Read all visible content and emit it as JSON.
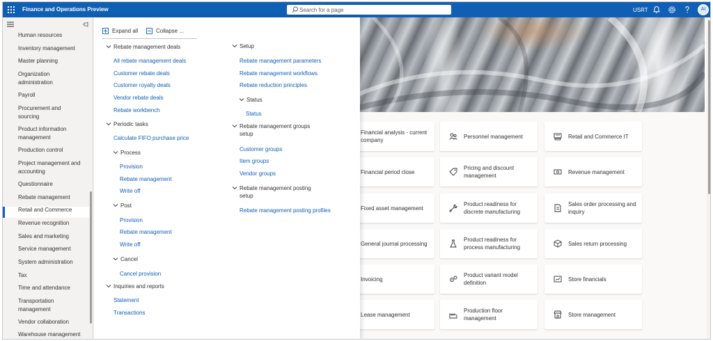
{
  "app": {
    "title": "Finance and Operations Preview",
    "company": "USRT",
    "avatar_initials": "AI",
    "accent_color": "#0f5fb4"
  },
  "search": {
    "placeholder": "Search for a page"
  },
  "topbar_icons": [
    "waffle-icon",
    "search-icon",
    "bell-icon",
    "gear-icon",
    "help-icon"
  ],
  "nav": {
    "items": [
      "Human resources",
      "Inventory management",
      "Master planning",
      "Organization administration",
      "Payroll",
      "Procurement and sourcing",
      "Product information management",
      "Production control",
      "Project management and accounting",
      "Questionnaire",
      "Rebate management",
      "Retail and Commerce",
      "Revenue recognition",
      "Sales and marketing",
      "Service management",
      "System administration",
      "Tax",
      "Time and attendance",
      "Transportation management",
      "Vendor collaboration",
      "Warehouse management"
    ],
    "selected": "Rebate management"
  },
  "flyout": {
    "expand_all": "Expand all",
    "collapse_all": "Collapse ...",
    "left": {
      "deals_header": "Rebate management deals",
      "deals_links": [
        "All rebate management deals",
        "Customer rebate deals",
        "Customer royalty deals",
        "Vendor rebate deals",
        "Rebate workbench"
      ],
      "periodic_header": "Periodic tasks",
      "fifo_link": "Calculate FIFO purchase price",
      "process_header": "Process",
      "process_links": [
        "Provision",
        "Rebate management",
        "Write off"
      ],
      "post_header": "Post",
      "post_links": [
        "Provision",
        "Rebate management",
        "Write off"
      ],
      "cancel_header": "Cancel",
      "cancel_links": [
        "Cancel provision"
      ],
      "inquiries_header": "Inquiries and reports",
      "inquiries_links": [
        "Statement",
        "Transactions"
      ]
    },
    "right": {
      "setup_header": "Setup",
      "setup_links": [
        "Rebate management parameters",
        "Rebate management workflows",
        "Rebate reduction principles"
      ],
      "status_header": "Status",
      "status_links": [
        "Status"
      ],
      "groups_header": "Rebate management groups setup",
      "groups_links": [
        "Customer groups",
        "Item groups",
        "Vendor groups"
      ],
      "posting_header": "Rebate management posting setup",
      "posting_links": [
        "Rebate management posting profiles"
      ]
    }
  },
  "tiles": {
    "col1": [
      "Financial analysis - current company",
      "Financial period close",
      "Fixed asset management",
      "General journal processing",
      "Invoicing",
      "Lease management"
    ],
    "col2": [
      "Personnel management",
      "Pricing and discount management",
      "Product readiness for discrete manufacturing",
      "Product readiness for process manufacturing",
      "Product variant model definition",
      "Production floor management"
    ],
    "col3": [
      "Retail and Commerce IT",
      "Revenue management",
      "Sales order processing and inquiry",
      "Sales return processing",
      "Store financials",
      "Store management"
    ]
  }
}
